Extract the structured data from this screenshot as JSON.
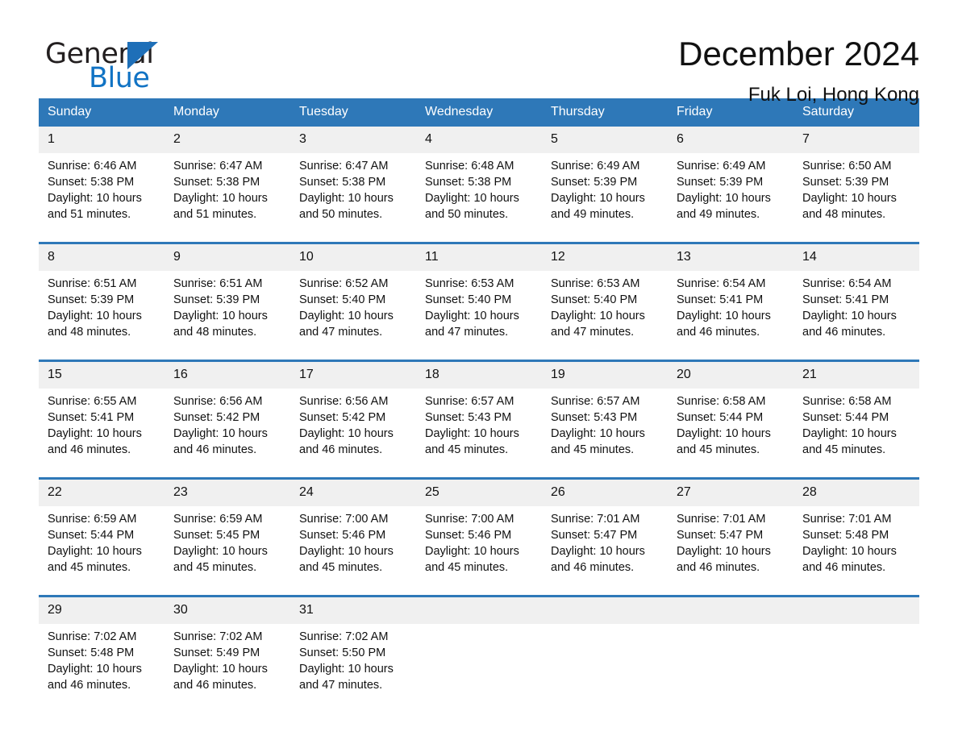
{
  "brand": {
    "name_part1": "General",
    "name_part2": "Blue",
    "logo_icon": "blue-triangle-icon",
    "accent_color": "#1173c4"
  },
  "header": {
    "title": "December 2024",
    "subtitle": "Fuk Loi, Hong Kong"
  },
  "theme": {
    "header_blue": "#2e78b8",
    "date_band_grey": "#f0f0f0",
    "rule_blue": "#2e78b8"
  },
  "calendar": {
    "weekday_headers": [
      "Sunday",
      "Monday",
      "Tuesday",
      "Wednesday",
      "Thursday",
      "Friday",
      "Saturday"
    ],
    "weeks": [
      {
        "dates": [
          "1",
          "2",
          "3",
          "4",
          "5",
          "6",
          "7"
        ],
        "days": [
          {
            "sunrise": "Sunrise: 6:46 AM",
            "sunset": "Sunset: 5:38 PM",
            "daylight_line1": "Daylight: 10 hours",
            "daylight_line2": "and 51 minutes."
          },
          {
            "sunrise": "Sunrise: 6:47 AM",
            "sunset": "Sunset: 5:38 PM",
            "daylight_line1": "Daylight: 10 hours",
            "daylight_line2": "and 51 minutes."
          },
          {
            "sunrise": "Sunrise: 6:47 AM",
            "sunset": "Sunset: 5:38 PM",
            "daylight_line1": "Daylight: 10 hours",
            "daylight_line2": "and 50 minutes."
          },
          {
            "sunrise": "Sunrise: 6:48 AM",
            "sunset": "Sunset: 5:38 PM",
            "daylight_line1": "Daylight: 10 hours",
            "daylight_line2": "and 50 minutes."
          },
          {
            "sunrise": "Sunrise: 6:49 AM",
            "sunset": "Sunset: 5:39 PM",
            "daylight_line1": "Daylight: 10 hours",
            "daylight_line2": "and 49 minutes."
          },
          {
            "sunrise": "Sunrise: 6:49 AM",
            "sunset": "Sunset: 5:39 PM",
            "daylight_line1": "Daylight: 10 hours",
            "daylight_line2": "and 49 minutes."
          },
          {
            "sunrise": "Sunrise: 6:50 AM",
            "sunset": "Sunset: 5:39 PM",
            "daylight_line1": "Daylight: 10 hours",
            "daylight_line2": "and 48 minutes."
          }
        ]
      },
      {
        "dates": [
          "8",
          "9",
          "10",
          "11",
          "12",
          "13",
          "14"
        ],
        "days": [
          {
            "sunrise": "Sunrise: 6:51 AM",
            "sunset": "Sunset: 5:39 PM",
            "daylight_line1": "Daylight: 10 hours",
            "daylight_line2": "and 48 minutes."
          },
          {
            "sunrise": "Sunrise: 6:51 AM",
            "sunset": "Sunset: 5:39 PM",
            "daylight_line1": "Daylight: 10 hours",
            "daylight_line2": "and 48 minutes."
          },
          {
            "sunrise": "Sunrise: 6:52 AM",
            "sunset": "Sunset: 5:40 PM",
            "daylight_line1": "Daylight: 10 hours",
            "daylight_line2": "and 47 minutes."
          },
          {
            "sunrise": "Sunrise: 6:53 AM",
            "sunset": "Sunset: 5:40 PM",
            "daylight_line1": "Daylight: 10 hours",
            "daylight_line2": "and 47 minutes."
          },
          {
            "sunrise": "Sunrise: 6:53 AM",
            "sunset": "Sunset: 5:40 PM",
            "daylight_line1": "Daylight: 10 hours",
            "daylight_line2": "and 47 minutes."
          },
          {
            "sunrise": "Sunrise: 6:54 AM",
            "sunset": "Sunset: 5:41 PM",
            "daylight_line1": "Daylight: 10 hours",
            "daylight_line2": "and 46 minutes."
          },
          {
            "sunrise": "Sunrise: 6:54 AM",
            "sunset": "Sunset: 5:41 PM",
            "daylight_line1": "Daylight: 10 hours",
            "daylight_line2": "and 46 minutes."
          }
        ]
      },
      {
        "dates": [
          "15",
          "16",
          "17",
          "18",
          "19",
          "20",
          "21"
        ],
        "days": [
          {
            "sunrise": "Sunrise: 6:55 AM",
            "sunset": "Sunset: 5:41 PM",
            "daylight_line1": "Daylight: 10 hours",
            "daylight_line2": "and 46 minutes."
          },
          {
            "sunrise": "Sunrise: 6:56 AM",
            "sunset": "Sunset: 5:42 PM",
            "daylight_line1": "Daylight: 10 hours",
            "daylight_line2": "and 46 minutes."
          },
          {
            "sunrise": "Sunrise: 6:56 AM",
            "sunset": "Sunset: 5:42 PM",
            "daylight_line1": "Daylight: 10 hours",
            "daylight_line2": "and 46 minutes."
          },
          {
            "sunrise": "Sunrise: 6:57 AM",
            "sunset": "Sunset: 5:43 PM",
            "daylight_line1": "Daylight: 10 hours",
            "daylight_line2": "and 45 minutes."
          },
          {
            "sunrise": "Sunrise: 6:57 AM",
            "sunset": "Sunset: 5:43 PM",
            "daylight_line1": "Daylight: 10 hours",
            "daylight_line2": "and 45 minutes."
          },
          {
            "sunrise": "Sunrise: 6:58 AM",
            "sunset": "Sunset: 5:44 PM",
            "daylight_line1": "Daylight: 10 hours",
            "daylight_line2": "and 45 minutes."
          },
          {
            "sunrise": "Sunrise: 6:58 AM",
            "sunset": "Sunset: 5:44 PM",
            "daylight_line1": "Daylight: 10 hours",
            "daylight_line2": "and 45 minutes."
          }
        ]
      },
      {
        "dates": [
          "22",
          "23",
          "24",
          "25",
          "26",
          "27",
          "28"
        ],
        "days": [
          {
            "sunrise": "Sunrise: 6:59 AM",
            "sunset": "Sunset: 5:44 PM",
            "daylight_line1": "Daylight: 10 hours",
            "daylight_line2": "and 45 minutes."
          },
          {
            "sunrise": "Sunrise: 6:59 AM",
            "sunset": "Sunset: 5:45 PM",
            "daylight_line1": "Daylight: 10 hours",
            "daylight_line2": "and 45 minutes."
          },
          {
            "sunrise": "Sunrise: 7:00 AM",
            "sunset": "Sunset: 5:46 PM",
            "daylight_line1": "Daylight: 10 hours",
            "daylight_line2": "and 45 minutes."
          },
          {
            "sunrise": "Sunrise: 7:00 AM",
            "sunset": "Sunset: 5:46 PM",
            "daylight_line1": "Daylight: 10 hours",
            "daylight_line2": "and 45 minutes."
          },
          {
            "sunrise": "Sunrise: 7:01 AM",
            "sunset": "Sunset: 5:47 PM",
            "daylight_line1": "Daylight: 10 hours",
            "daylight_line2": "and 46 minutes."
          },
          {
            "sunrise": "Sunrise: 7:01 AM",
            "sunset": "Sunset: 5:47 PM",
            "daylight_line1": "Daylight: 10 hours",
            "daylight_line2": "and 46 minutes."
          },
          {
            "sunrise": "Sunrise: 7:01 AM",
            "sunset": "Sunset: 5:48 PM",
            "daylight_line1": "Daylight: 10 hours",
            "daylight_line2": "and 46 minutes."
          }
        ]
      },
      {
        "dates": [
          "29",
          "30",
          "31",
          "",
          "",
          "",
          ""
        ],
        "days": [
          {
            "sunrise": "Sunrise: 7:02 AM",
            "sunset": "Sunset: 5:48 PM",
            "daylight_line1": "Daylight: 10 hours",
            "daylight_line2": "and 46 minutes."
          },
          {
            "sunrise": "Sunrise: 7:02 AM",
            "sunset": "Sunset: 5:49 PM",
            "daylight_line1": "Daylight: 10 hours",
            "daylight_line2": "and 46 minutes."
          },
          {
            "sunrise": "Sunrise: 7:02 AM",
            "sunset": "Sunset: 5:50 PM",
            "daylight_line1": "Daylight: 10 hours",
            "daylight_line2": "and 47 minutes."
          },
          {
            "sunrise": "",
            "sunset": "",
            "daylight_line1": "",
            "daylight_line2": ""
          },
          {
            "sunrise": "",
            "sunset": "",
            "daylight_line1": "",
            "daylight_line2": ""
          },
          {
            "sunrise": "",
            "sunset": "",
            "daylight_line1": "",
            "daylight_line2": ""
          },
          {
            "sunrise": "",
            "sunset": "",
            "daylight_line1": "",
            "daylight_line2": ""
          }
        ]
      }
    ]
  }
}
